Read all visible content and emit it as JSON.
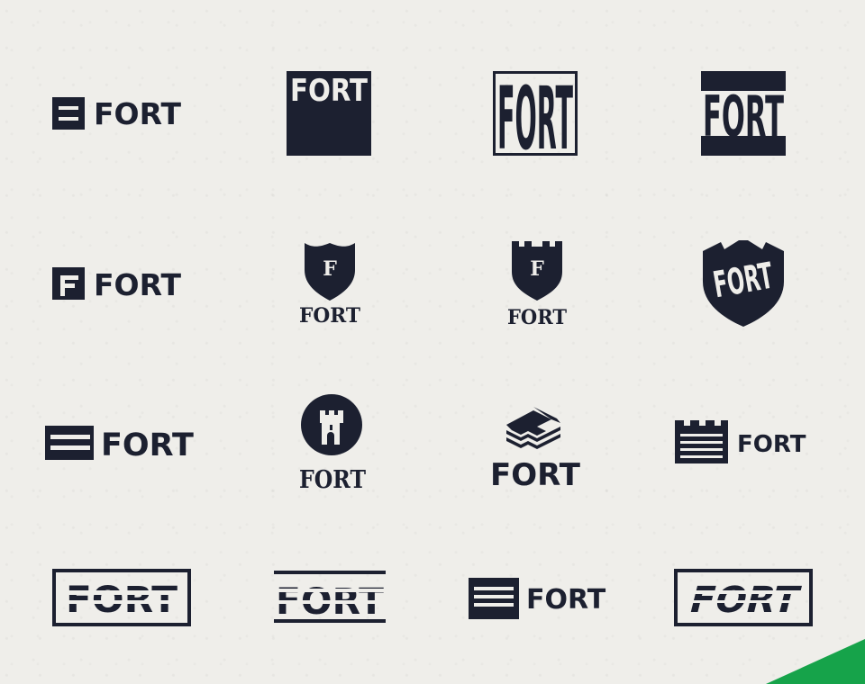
{
  "brand": {
    "wordmark": "FORT",
    "monogram": "F",
    "ink_color": "#1c2030",
    "paper_color": "#efeeea",
    "accent_color": "#16a34a"
  },
  "logos": [
    {
      "id": "logo-1",
      "variant": "stacked-square-icon-wordmark"
    },
    {
      "id": "logo-2",
      "variant": "wordmark-on-block"
    },
    {
      "id": "logo-3",
      "variant": "tall-condensed-framed"
    },
    {
      "id": "logo-4",
      "variant": "knockout-block"
    },
    {
      "id": "logo-5",
      "variant": "f-square-icon-wordmark"
    },
    {
      "id": "logo-6",
      "variant": "shield-monogram"
    },
    {
      "id": "logo-7",
      "variant": "castle-shield-monogram"
    },
    {
      "id": "logo-8",
      "variant": "castle-shield-wordmark"
    },
    {
      "id": "logo-9",
      "variant": "bars-icon-wordmark"
    },
    {
      "id": "logo-10",
      "variant": "tower-circle"
    },
    {
      "id": "logo-11",
      "variant": "layered-f-isometric"
    },
    {
      "id": "logo-12",
      "variant": "battlement-icon-wordmark"
    },
    {
      "id": "logo-13",
      "variant": "sliced-wordmark-framed"
    },
    {
      "id": "logo-14",
      "variant": "sliced-wordmark-lines"
    },
    {
      "id": "logo-15",
      "variant": "striped-square-icon-wordmark"
    },
    {
      "id": "logo-16",
      "variant": "italic-sliced-framed"
    }
  ],
  "icons": [
    "square-bars-icon",
    "shield-icon",
    "castle-tower-icon",
    "layered-f-icon",
    "battlement-icon"
  ]
}
